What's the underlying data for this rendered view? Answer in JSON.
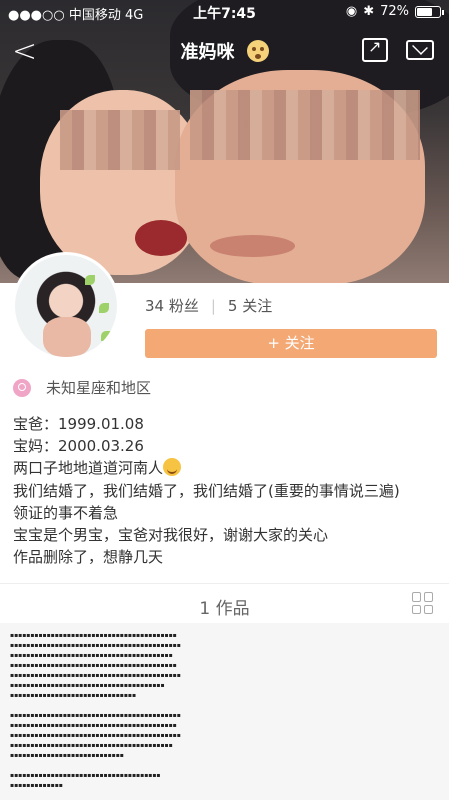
{
  "status_bar": {
    "carrier": "中国移动",
    "network": "4G",
    "time": "上午7:45",
    "battery_percent": "72%",
    "battery_level": 0.72
  },
  "nav": {
    "title": "准妈咪",
    "back_icon": "chevron-left-icon",
    "share_icon": "share-icon",
    "message_icon": "mail-icon"
  },
  "profile": {
    "followers": "34 粉丝",
    "following": "5 关注",
    "follow_button": "+ 关注",
    "location": "未知星座和地区"
  },
  "bio": {
    "line1": "宝爸：1999.01.08",
    "line2": "宝妈：2000.03.26",
    "line3": "两口子地地道道河南人",
    "line4": "我们结婚了，我们结婚了，我们结婚了(重要的事情说三遍)",
    "line5": "领证的事不着急",
    "line6": "宝宝是个男宝，宝爸对我很好，谢谢大家的关心",
    "line7": "作品删除了，想静几天"
  },
  "works": {
    "count_label": "1 作品",
    "grid_icon": "grid-view-icon"
  },
  "colors": {
    "follow_button": "#f4a874",
    "location_icon": "#f0a5c7"
  }
}
